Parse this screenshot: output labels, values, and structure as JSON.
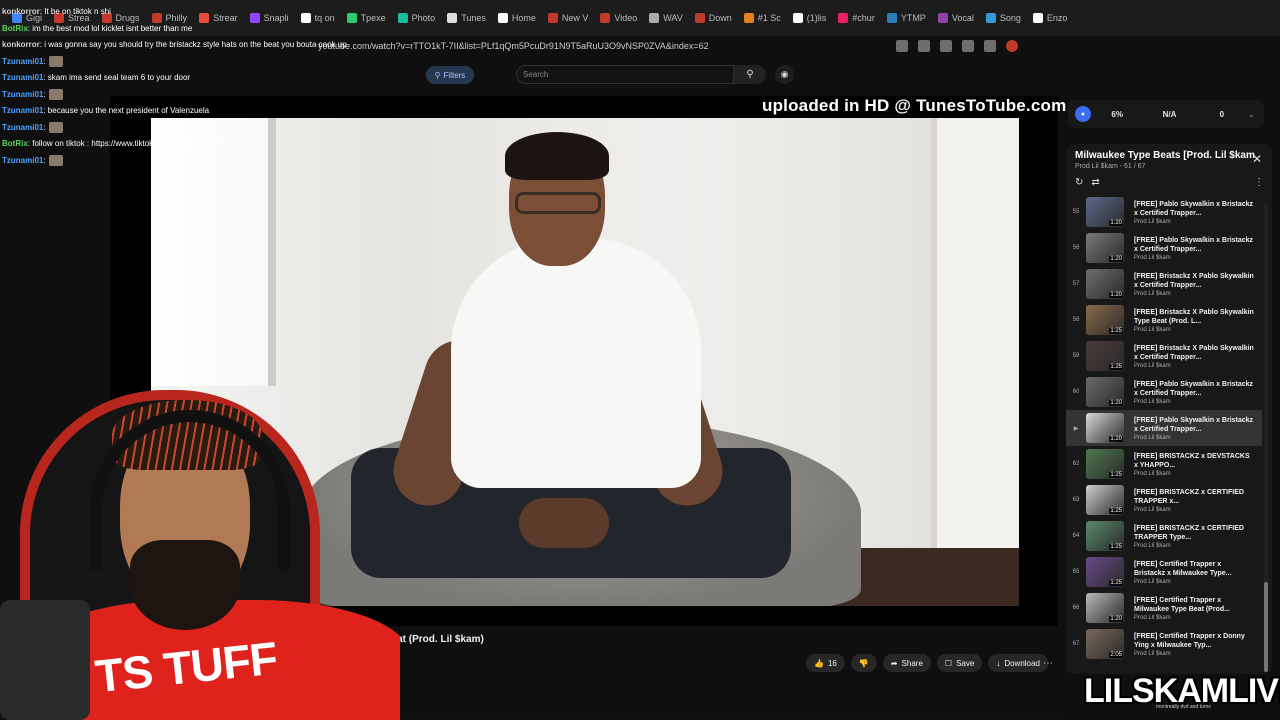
{
  "tabs": [
    {
      "label": "Gigi",
      "color": "#4285f4"
    },
    {
      "label": "Strea",
      "color": "#c0392b"
    },
    {
      "label": "Drugs",
      "color": "#c0392b"
    },
    {
      "label": "Philly",
      "color": "#c0392b"
    },
    {
      "label": "Strear",
      "color": "#e74c3c"
    },
    {
      "label": "Snapli",
      "color": "#9146ff"
    },
    {
      "label": "tq on",
      "color": "#ffffff"
    },
    {
      "label": "Tpexe",
      "color": "#2ecc71"
    },
    {
      "label": "Photo",
      "color": "#1abc9c"
    },
    {
      "label": "Tunes",
      "color": "#dddddd"
    },
    {
      "label": "Home",
      "color": "#ffffff"
    },
    {
      "label": "New V",
      "color": "#c0392b"
    },
    {
      "label": "Video",
      "color": "#c0392b"
    },
    {
      "label": "WAV",
      "color": "#aaaaaa"
    },
    {
      "label": "Down",
      "color": "#c0392b"
    },
    {
      "label": "#1 Sc",
      "color": "#e67e22"
    },
    {
      "label": "(1)lis",
      "color": "#ffffff"
    },
    {
      "label": "#chur",
      "color": "#e91e63"
    },
    {
      "label": "YTMP",
      "color": "#2980b9"
    },
    {
      "label": "Vocal",
      "color": "#8e44ad"
    },
    {
      "label": "Song",
      "color": "#3498db"
    },
    {
      "label": "Enzo",
      "color": "#ffffff"
    }
  ],
  "address": {
    "url": "youtube.com/watch?v=rTTO1kT-7II&list=PLf1qQm5PcuDr91N9T5aRuU3O9vNSP0ZVA&index=62"
  },
  "chat": [
    {
      "user": "konkorror",
      "text": ": It be on tiktok n shi",
      "kind": "konk",
      "emote": false
    },
    {
      "user": "BotRix",
      "text": ": im the best mod lol kicklet isnt better than me",
      "kind": "bot",
      "emote": false
    },
    {
      "user": "konkorror",
      "text": ": i was gonna say you should try the bristackz style hats on the beat you bouta cook up",
      "kind": "konk",
      "emote": false
    },
    {
      "user": "Tzunami01",
      "text": ":",
      "kind": "user",
      "emote": true
    },
    {
      "user": "Tzunami01",
      "text": ": skam ima send seal team 6 to your door",
      "kind": "user",
      "emote": false
    },
    {
      "user": "Tzunami01",
      "text": ":",
      "kind": "user",
      "emote": true
    },
    {
      "user": "Tzunami01",
      "text": ": because you the next president of Valenzuela",
      "kind": "user",
      "emote": false
    },
    {
      "user": "Tzunami01",
      "text": ":",
      "kind": "user",
      "emote": true
    },
    {
      "user": "BotRix",
      "text": ": follow on tiktok : https://www.tiktok.com/@lilskamlive",
      "kind": "bot",
      "emote": false
    },
    {
      "user": "Tzunami01",
      "text": ":",
      "kind": "user",
      "emote": true
    }
  ],
  "header": {
    "filters_label": "Filters",
    "search_placeholder": "Search"
  },
  "video": {
    "watermark": "uploaded in HD @ TunesToTube.com",
    "title_fragment": "e Beat (Prod. Lil $kam)"
  },
  "actions": {
    "like_count": "16",
    "share_label": "Share",
    "save_label": "Save",
    "download_label": "Download"
  },
  "stats": {
    "pct": "6%",
    "na": "N/A",
    "zero": "0"
  },
  "webcam": {
    "shirt_text": "TS TUFF"
  },
  "playlist": {
    "title": "Milwaukee Type Beats [Prod. Lil $kam]",
    "subtitle": "Prod Lil $kam - 61 / 67",
    "items": [
      {
        "index": "55",
        "title": "[FREE] Pablo Skywalkin x Bristackz x Certified Trapper...",
        "channel": "Prod Lil $kam",
        "duration": "1:20",
        "active": false,
        "thumb": "#5a6a8a"
      },
      {
        "index": "56",
        "title": "[FREE] Pablo Skywalkin x Bristackz x Certified Trapper...",
        "channel": "Prod Lil $kam",
        "duration": "1:20",
        "active": false,
        "thumb": "#7a7a7a"
      },
      {
        "index": "57",
        "title": "[FREE] Bristackz X Pablo Skywalkin x Certified Trapper...",
        "channel": "Prod Lil $kam",
        "duration": "1:20",
        "active": false,
        "thumb": "#6e6e6e"
      },
      {
        "index": "58",
        "title": "[FREE] Bristackz X Pablo Skywalkin Type Beat (Prod. L...",
        "channel": "Prod Lil $kam",
        "duration": "1:25",
        "active": false,
        "thumb": "#8a6a4a"
      },
      {
        "index": "59",
        "title": "[FREE] Bristackz X Pablo Skywalkin x Certified Trapper...",
        "channel": "Prod Lil $kam",
        "duration": "1:25",
        "active": false,
        "thumb": "#4a3a3a"
      },
      {
        "index": "60",
        "title": "[FREE] Pablo Skywalkin x Bristackz x Certified Trapper...",
        "channel": "Prod Lil $kam",
        "duration": "1:20",
        "active": false,
        "thumb": "#6a6a6a"
      },
      {
        "index": "",
        "title": "[FREE] Pablo Skywalkin x Bristackz x Certified Trapper...",
        "channel": "Prod Lil $kam",
        "duration": "1:20",
        "active": true,
        "thumb": "#d9d9d9"
      },
      {
        "index": "62",
        "title": "[FREE] BRISTACKZ x DEVSTACKS x YHAPPO...",
        "channel": "Prod Lil $kam",
        "duration": "1:25",
        "active": false,
        "thumb": "#4f7a4f"
      },
      {
        "index": "63",
        "title": "[FREE] BRISTACKZ x CERTIFIED TRAPPER x...",
        "channel": "Prod Lil $kam",
        "duration": "1:25",
        "active": false,
        "thumb": "#cfcfcf"
      },
      {
        "index": "64",
        "title": "[FREE] BRISTACKZ x CERTIFIED TRAPPER Type...",
        "channel": "Prod Lil $kam",
        "duration": "1:25",
        "active": false,
        "thumb": "#5a8a6a"
      },
      {
        "index": "65",
        "title": "[FREE] Certified Trapper x Bristackz x Milwaukee Type...",
        "channel": "Prod Lil $kam",
        "duration": "1:25",
        "active": false,
        "thumb": "#6a4a8a"
      },
      {
        "index": "66",
        "title": "[FREE] Certified Trapper x Milwaukee Type Beat (Prod...",
        "channel": "Prod Lil $kam",
        "duration": "1:20",
        "active": false,
        "thumb": "#b8b8b8"
      },
      {
        "index": "67",
        "title": "[FREE] Certified Trapper x Donny Ying x Milwaukee Typ...",
        "channel": "Prod Lil $kam",
        "duration": "2:05",
        "active": false,
        "thumb": "#7a6a5a"
      }
    ]
  },
  "brand": {
    "name": "LILSKAMLIVE",
    "sub": "montreally dvd and turns"
  }
}
